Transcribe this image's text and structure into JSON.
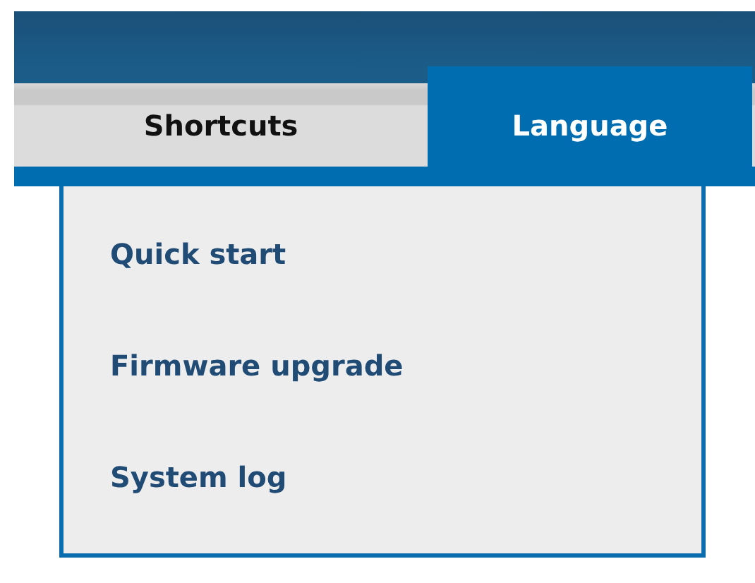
{
  "tabs": [
    {
      "label": "Shortcuts",
      "selected": false
    },
    {
      "label": "Language",
      "selected": true
    }
  ],
  "menu": {
    "items": [
      {
        "label": "Quick start"
      },
      {
        "label": "Firmware upgrade"
      },
      {
        "label": "System log"
      }
    ]
  }
}
